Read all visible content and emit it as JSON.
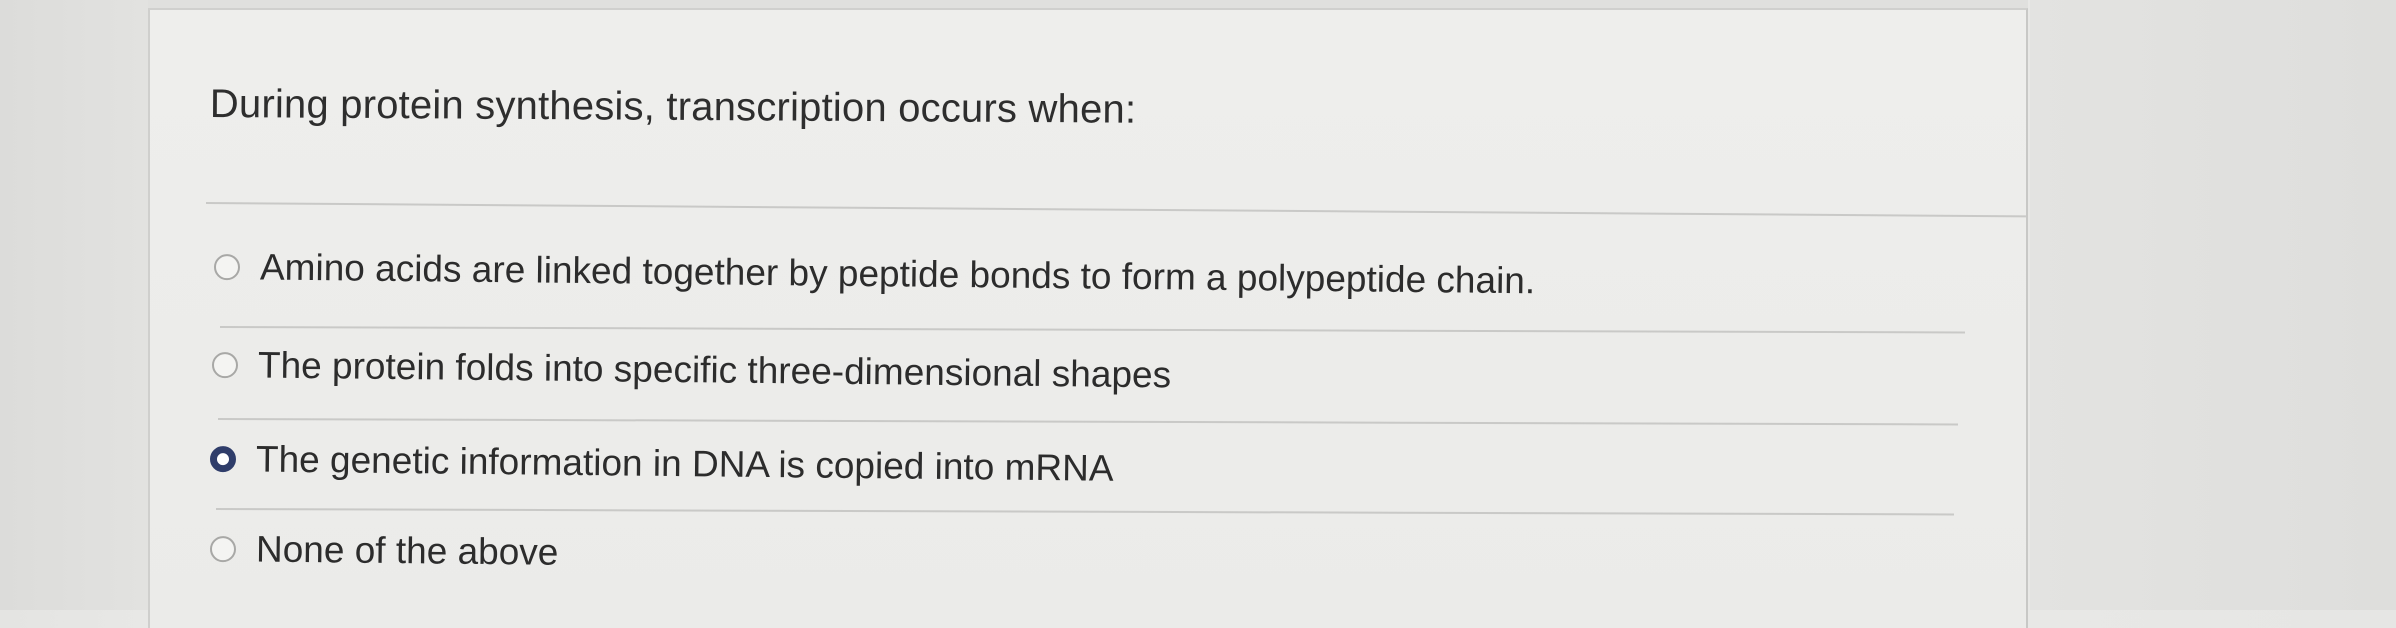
{
  "question": {
    "text": "During protein synthesis, transcription occurs when:"
  },
  "answers": [
    {
      "label": "Amino acids are linked together by peptide bonds to form a polypeptide chain.",
      "selected": false
    },
    {
      "label": "The protein folds into specific three-dimensional shapes",
      "selected": false
    },
    {
      "label": "The genetic information in DNA is copied into mRNA",
      "selected": true
    },
    {
      "label": "None of the above",
      "selected": false
    }
  ],
  "colors": {
    "selected_radio": "#2f3d6a",
    "text": "#2c2c2c"
  }
}
